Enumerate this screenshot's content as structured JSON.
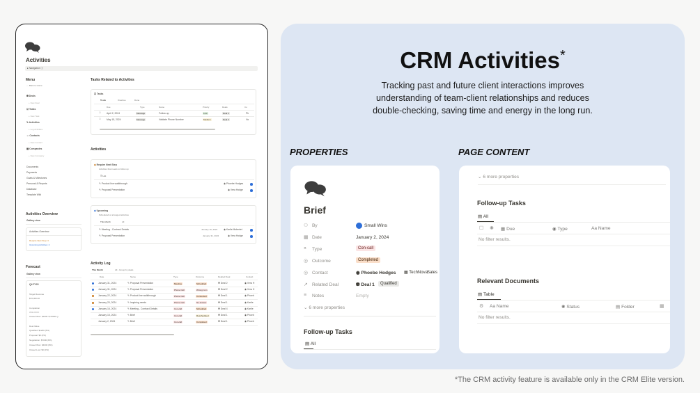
{
  "left": {
    "title": "Activities",
    "navigation": "Navigation",
    "menu": {
      "heading": "Menu",
      "back": "← Back to Home",
      "items": [
        {
          "label": "Deals",
          "sub": "+ New Deal"
        },
        {
          "label": "Tasks",
          "sub": "+ New Task"
        },
        {
          "label": "Activities",
          "sub": "+ Log Activities"
        },
        {
          "label": "Contacts",
          "sub": "+ New Contact"
        },
        {
          "label": "Companies",
          "sub": "+ New Company"
        }
      ],
      "more": [
        "Documents",
        "Payments",
        "Goals & Milestones",
        "Personal & Reports",
        "Database",
        "Template Wiki"
      ]
    },
    "overview": {
      "heading": "Activities Overview",
      "view": "Gallery view",
      "card_title": "Activities Overview",
      "l1": "Require Next Step: 3",
      "l2": "Upcoming Activities: 2"
    },
    "forecast": {
      "heading": "Forecast",
      "view": "Gallery view",
      "card_title": "Q4 FY23",
      "target_label": "Target Revenue",
      "target": "$70,000.00",
      "completion_label": "Completion",
      "completion": "74% ━━━━",
      "closed": "Closed Won: $1000 / $70000 ()",
      "deal_value": "Deal Value",
      "rows": [
        "Qualified: $1200 (5%)",
        "Proposal: $0 (0%)",
        "Negotiation: $7000 (8%)",
        "Closed Won: $4000 (8%)",
        "Closed Lost: $0 (0%)"
      ]
    },
    "tasks_section": {
      "heading": "Tasks Related to Activities",
      "db": "Tasks",
      "tabs": [
        "To do",
        "Overdue",
        "Done"
      ],
      "cols": [
        "Due",
        "Type",
        "Name",
        "Priority",
        "Deals",
        "Co"
      ],
      "rows": [
        [
          "April 2, 2024",
          "Message",
          "Follow up",
          "Low",
          "Deal 2",
          "Ph"
        ],
        [
          "May 15, 2024",
          "Message",
          "Validate Phone Number",
          "Medium",
          "Deal 3",
          "Va"
        ]
      ]
    },
    "activities_section": {
      "heading": "Activities",
      "box1": {
        "title": "Require Next Step",
        "desc": "Activities that needs to follow up",
        "view": "List",
        "items": [
          [
            "Product line walkthrough",
            "Phoebe Hodges"
          ],
          [
            "Proposal Presentation",
            "Vera Hodge"
          ]
        ]
      },
      "box2": {
        "title": "Upcoming",
        "desc": "Scheduled or arranged activities",
        "views": [
          "This Month",
          "All"
        ],
        "items": [
          [
            "Meeting - Contract Details",
            "January 16, 2024",
            "Karlie Moberlet"
          ],
          [
            "Proposal Presentation",
            "January 31, 2024",
            "Vera Hodge"
          ]
        ]
      }
    },
    "log": {
      "heading": "Activity Log",
      "views": [
        "This Month",
        "All - Group by deals"
      ],
      "cols": [
        "Date",
        "Name",
        "Type",
        "Outcome",
        "Related Deal",
        "Contact"
      ],
      "rows": [
        [
          "January 31, 2024",
          "Proposal Presentation",
          "Meeting",
          "Scheduled",
          "Deal 2",
          "Vera H"
        ],
        [
          "January 31, 2024",
          "Proposal Presentation",
          "Phone Call",
          "Wrong num",
          "Deal 2",
          "Vera H"
        ],
        [
          "January 22, 2024",
          "Product line walkthrough",
          "Phone Call",
          "Connected",
          "Deal 1",
          "Phoeb"
        ],
        [
          "January 20, 2024",
          "Inquiring needs",
          "Phone Call",
          "No answer",
          "Deal 1",
          "Karlie"
        ],
        [
          "January 16, 2024",
          "Meeting - Contract Details",
          "Con-call",
          "Scheduled",
          "Deal 4",
          "Karlie"
        ],
        [
          "January 15, 2024",
          "Brief",
          "Con-call",
          "Rescheduled",
          "Deal 1",
          "Phoeb"
        ],
        [
          "January 2, 2024",
          "Brief",
          "Con-call",
          "Completed",
          "Deal 1",
          "Phoeb"
        ]
      ]
    }
  },
  "right": {
    "title": "CRM Activities",
    "title_mark": "*",
    "desc": [
      "Tracking past and future client interactions improves",
      "understanding of team-client relationships and reduces",
      "double-checking, saving time and energy in the long run."
    ],
    "properties_heading": "PROPERTIES",
    "page_content_heading": "PAGE CONTENT",
    "prop_card": {
      "title": "Brief",
      "rows": [
        {
          "label": "By",
          "value": "Small Wins"
        },
        {
          "label": "Date",
          "value": "January 2, 2024"
        },
        {
          "label": "Type",
          "value": "Con-call"
        },
        {
          "label": "Outcome",
          "value": "Completed"
        },
        {
          "label": "Contact",
          "value": "Phoebe Hodges",
          "extra": "TechNova",
          "extra2": "Sales"
        },
        {
          "label": "Related Deal",
          "value": "Deal 1",
          "extra": "Qualified"
        },
        {
          "label": "Notes",
          "value": "Empty"
        }
      ],
      "more": "6 more properties",
      "section": "Follow-up Tasks",
      "tab": "All"
    },
    "content_card": {
      "more": "6 more properties",
      "followup": {
        "heading": "Follow-up Tasks",
        "tab": "All",
        "cols": [
          "Due",
          "Type",
          "Name"
        ],
        "empty": "No filter results."
      },
      "docs": {
        "heading": "Relevant Documents",
        "tab": "Table",
        "cols": [
          "Name",
          "Status",
          "Folder"
        ],
        "empty": "No filter results."
      }
    },
    "footnote": "*The CRM activity feature is available only in the CRM Elite version."
  },
  "colors": {
    "panel": "#dde6f3",
    "blue_dot": "#2e6fd8",
    "red_tag": "#fbe4e4",
    "green_tag": "#dbeddb"
  }
}
